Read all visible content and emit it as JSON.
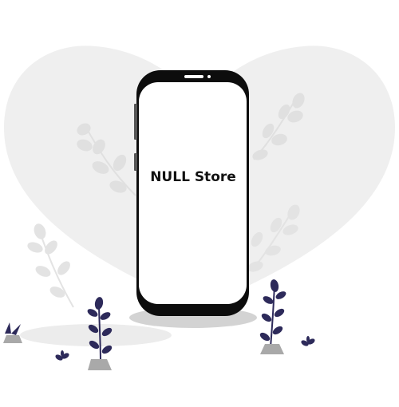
{
  "app": {
    "title": "NULL Store"
  },
  "colors": {
    "heart": "#efefef",
    "leaf_light": "#e3e3e3",
    "leaf_dark": "#2d2a5a",
    "phone_body": "#0d0d0d",
    "phone_screen": "#ffffff",
    "shadow": "#d6d6d6",
    "rock": "#a9a9a9"
  },
  "icons": [
    "heart-shape",
    "phone-device",
    "leaf-sprig",
    "rock"
  ]
}
